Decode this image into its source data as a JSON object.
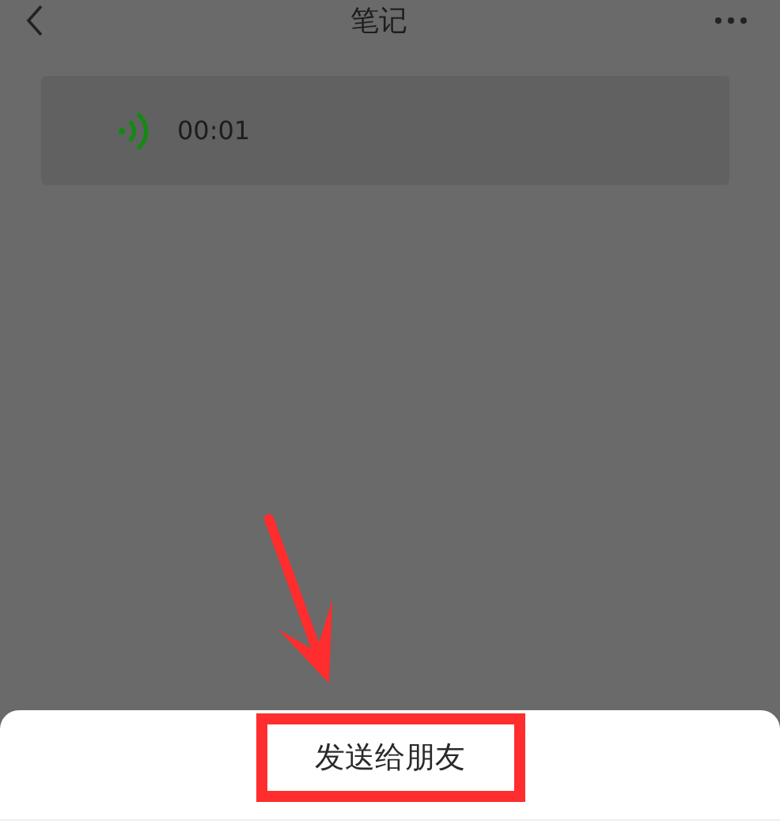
{
  "header": {
    "title": "笔记"
  },
  "voice_note": {
    "duration": "00:01"
  },
  "action_sheet": {
    "actions": [
      {
        "label": "发送给朋友",
        "highlighted": true
      }
    ]
  }
}
